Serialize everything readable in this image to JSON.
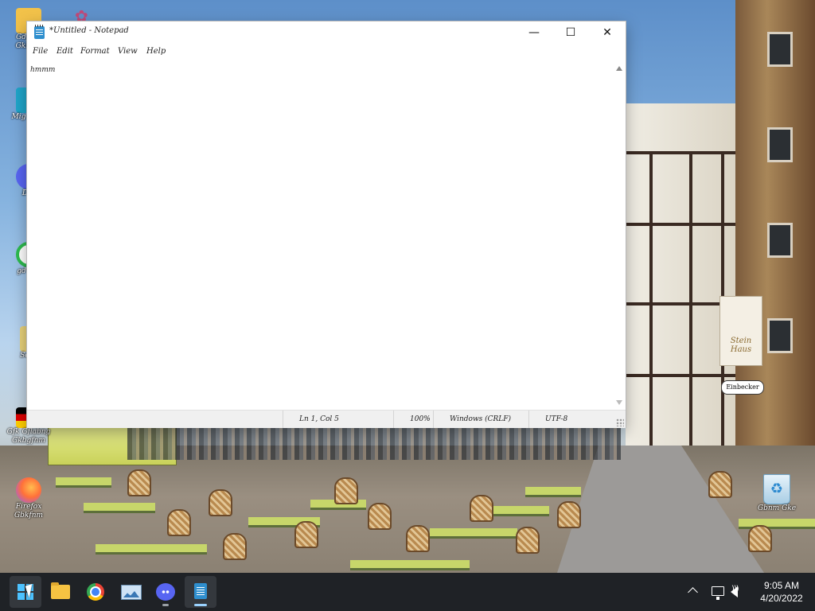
{
  "desktop": {
    "icons": [
      {
        "name": "desktop-icon-folder",
        "label": "Gdfsgk Gkbgnj",
        "color": "#f2c24a"
      },
      {
        "name": "desktop-icon-app-teal",
        "label": "Mig Gbnf",
        "color": "#1fa5c9"
      },
      {
        "name": "desktop-icon-discord-shortcut",
        "label": "Dsr",
        "color": "#5865f2"
      },
      {
        "name": "desktop-icon-green-app",
        "label": "gd Gsf",
        "color": "#2dbb4e"
      },
      {
        "name": "desktop-icon-image",
        "label": "Sebr",
        "color": "#e8d27a"
      },
      {
        "name": "desktop-icon-german-flag",
        "label": "Gfk Gflabng Gkbgfnm",
        "color": "#dd0000"
      },
      {
        "name": "desktop-icon-firefox",
        "label": "Firefox Gbkfnm",
        "color": "#ff7139"
      }
    ],
    "recycle_bin": {
      "label": "Gbnm Gke"
    },
    "banner_text": "Stein Haus",
    "sign_text": "Einbecker"
  },
  "notepad": {
    "title": "*Untitled - Notepad",
    "menu": [
      "File",
      "Edit",
      "Format",
      "View",
      "Help"
    ],
    "editor_text": "hmmm",
    "status": {
      "position": "Ln 1, Col 5",
      "zoom": "100%",
      "line_ending": "Windows (CRLF)",
      "encoding": "UTF-8"
    },
    "buttons": {
      "minimize": "—",
      "maximize": "☐",
      "close": "✕"
    }
  },
  "taskbar": {
    "apps": [
      "start",
      "file-explorer",
      "chrome",
      "photos",
      "discord",
      "notepad"
    ],
    "time": "9:05 AM",
    "date": "4/20/2022"
  }
}
